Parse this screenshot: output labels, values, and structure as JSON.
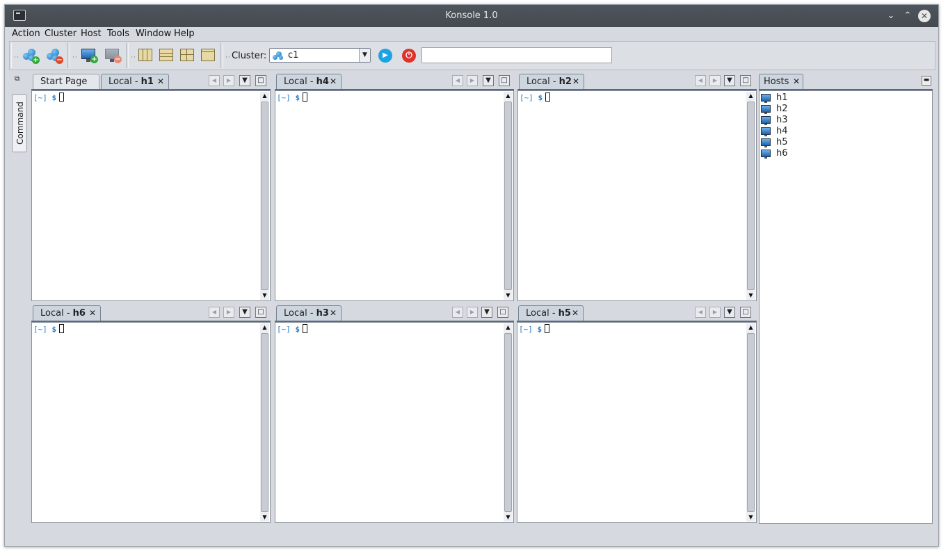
{
  "window": {
    "title": "Konsole 1.0"
  },
  "menu": [
    "Action",
    "Cluster",
    "Host",
    "Tools",
    "Window",
    "Help"
  ],
  "toolbar": {
    "cluster_label": "Cluster:",
    "cluster_value": "c1",
    "command_value": ""
  },
  "side": {
    "command_tab": "Command"
  },
  "panes": [
    {
      "tabs": [
        {
          "label": "Start Page",
          "active": false,
          "closable": false
        },
        {
          "prefix": "Local - ",
          "host": "h1",
          "active": true,
          "closable": true
        }
      ]
    },
    {
      "tabs": [
        {
          "prefix": "Local - ",
          "host": "h4",
          "active": true,
          "closable": true
        }
      ]
    },
    {
      "tabs": [
        {
          "prefix": "Local - ",
          "host": "h2",
          "active": true,
          "closable": true
        }
      ]
    },
    {
      "tabs": [
        {
          "prefix": "Local - ",
          "host": "h6",
          "active": true,
          "closable": true
        }
      ]
    },
    {
      "tabs": [
        {
          "prefix": "Local - ",
          "host": "h3",
          "active": true,
          "closable": true
        }
      ]
    },
    {
      "tabs": [
        {
          "prefix": "Local - ",
          "host": "h5",
          "active": true,
          "closable": true
        }
      ]
    }
  ],
  "terminal": {
    "prompt": "[~]",
    "symbol": "$"
  },
  "hosts": {
    "title": "Hosts",
    "items": [
      "h1",
      "h2",
      "h3",
      "h4",
      "h5",
      "h6"
    ]
  },
  "colors": {
    "titlebar": "#4f555c",
    "prompt": "#2a7bc6",
    "accent_play": "#1ba3e6",
    "accent_power": "#e0312a"
  }
}
